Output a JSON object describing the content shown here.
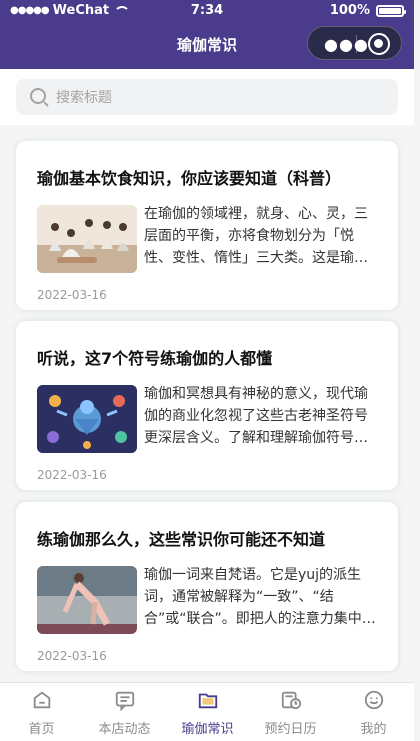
{
  "status_bar": {
    "carrier": "WeChat",
    "time": "7:34",
    "battery": "100%"
  },
  "nav": {
    "title": "瑜伽常识",
    "more_icon": "more-dots-icon",
    "capsule_icon": "target-icon"
  },
  "search": {
    "placeholder": "搜索标题",
    "icon": "search-icon"
  },
  "articles": [
    {
      "title": "瑜伽基本饮食知识，你应该要知道（科普）",
      "desc": "在瑜伽的领域裡，就身、心、灵，三层面的平衡，亦将食物划分为「悦性、变性、惰性」三大类。这是瑜伽的饮食观。",
      "date": "2022-03-16",
      "thumb": "yoga-class-photo"
    },
    {
      "title": "听说，这7个符号练瑜伽的人都懂",
      "desc": "瑜伽和冥想具有神秘的意义，现代瑜伽的商业化忽视了这些古老神圣符号更深层含义。了解和理解瑜伽符号的意义。",
      "date": "2022-03-16",
      "thumb": "yoga-symbols-illustration"
    },
    {
      "title": "练瑜伽那么久，这些常识你可能还不知道",
      "desc": "瑜伽一词来自梵语。它是yuj的派生词，通常被解释为“一致”、“结合”或“联合”。即把人的注意力集中起来。",
      "date": "2022-03-16",
      "thumb": "yoga-pose-photo"
    }
  ],
  "tabs": [
    {
      "label": "首页",
      "icon": "home-icon",
      "active": false
    },
    {
      "label": "本店动态",
      "icon": "message-icon",
      "active": false
    },
    {
      "label": "瑜伽常识",
      "icon": "folder-icon",
      "active": true
    },
    {
      "label": "预约日历",
      "icon": "calendar-clock-icon",
      "active": false
    },
    {
      "label": "我的",
      "icon": "smile-icon",
      "active": false
    }
  ],
  "colors": {
    "brand": "#4a3b8c",
    "tab_inactive": "#8c8c8c",
    "date": "#9a9a9a"
  }
}
